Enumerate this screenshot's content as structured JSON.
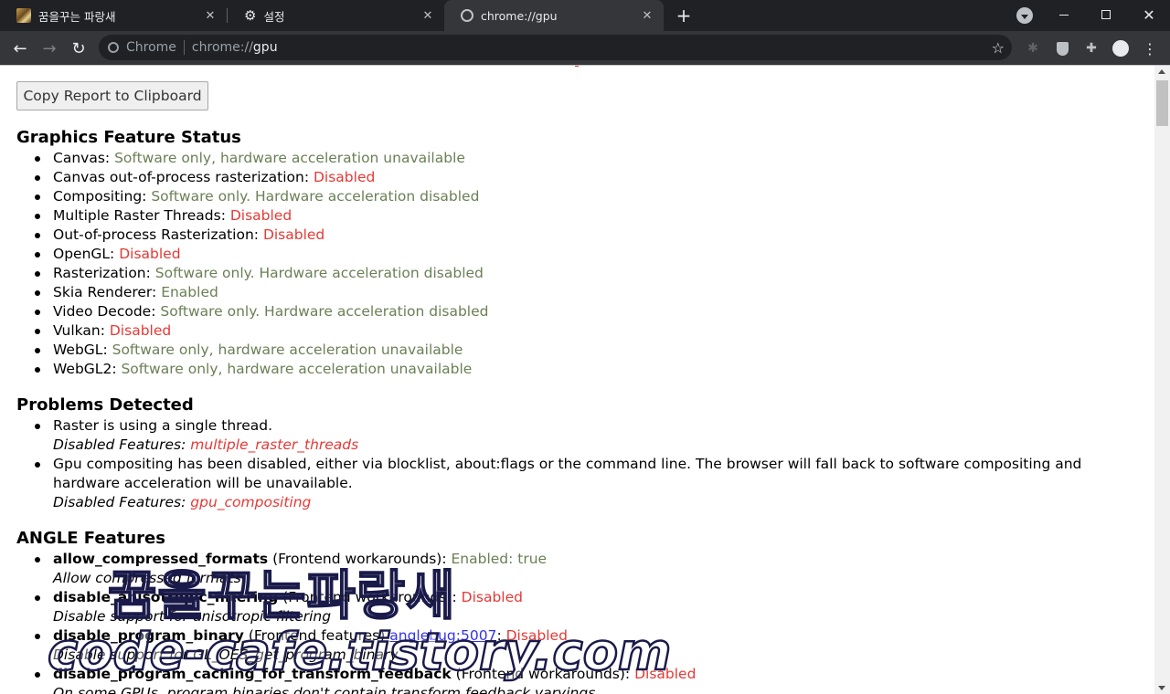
{
  "tabs": [
    {
      "title": "꿈을꾸는 파랑새",
      "favicon": "blog-avatar-icon"
    },
    {
      "title": "설정",
      "favicon": "settings-gear-icon"
    },
    {
      "title": "chrome://gpu",
      "favicon": "chrome-page-icon",
      "active": true
    }
  ],
  "omnibox": {
    "chip": "Chrome",
    "url_prefix": "chrome://",
    "url_host": "gpu"
  },
  "page": {
    "copy_button": "Copy Report to Clipboard",
    "feature_status": {
      "title": "Graphics Feature Status",
      "items": [
        {
          "name": "Canvas",
          "value": "Software only, hardware acceleration unavailable",
          "status": "software"
        },
        {
          "name": "Canvas out-of-process rasterization",
          "value": "Disabled",
          "status": "disabled"
        },
        {
          "name": "Compositing",
          "value": "Software only. Hardware acceleration disabled",
          "status": "software"
        },
        {
          "name": "Multiple Raster Threads",
          "value": "Disabled",
          "status": "disabled"
        },
        {
          "name": "Out-of-process Rasterization",
          "value": "Disabled",
          "status": "disabled"
        },
        {
          "name": "OpenGL",
          "value": "Disabled",
          "status": "disabled"
        },
        {
          "name": "Rasterization",
          "value": "Software only. Hardware acceleration disabled",
          "status": "software"
        },
        {
          "name": "Skia Renderer",
          "value": "Enabled",
          "status": "enabled"
        },
        {
          "name": "Video Decode",
          "value": "Software only. Hardware acceleration disabled",
          "status": "software"
        },
        {
          "name": "Vulkan",
          "value": "Disabled",
          "status": "disabled"
        },
        {
          "name": "WebGL",
          "value": "Software only, hardware acceleration unavailable",
          "status": "software"
        },
        {
          "name": "WebGL2",
          "value": "Software only, hardware acceleration unavailable",
          "status": "software"
        }
      ]
    },
    "problems": {
      "title": "Problems Detected",
      "items": [
        {
          "text": "Raster is using a single thread.",
          "disabled_label": "Disabled Features:",
          "feature": "multiple_raster_threads"
        },
        {
          "text": "Gpu compositing has been disabled, either via blocklist, about:flags or the command line. The browser will fall back to software compositing and hardware acceleration will be unavailable.",
          "disabled_label": "Disabled Features:",
          "feature": "gpu_compositing"
        }
      ]
    },
    "angle": {
      "title": "ANGLE Features",
      "items": [
        {
          "name": "allow_compressed_formats",
          "category": "(Frontend workarounds):",
          "state": "Enabled:",
          "state_value": "true",
          "description": "Allow compressed formats"
        },
        {
          "name": "disable_anisotropic_filtering",
          "category": "(Frontend workarounds):",
          "state": "Disabled",
          "description": "Disable support for anisotropic filtering"
        },
        {
          "name": "disable_program_binary",
          "category": "(Frontend features)",
          "link": "anglebug:5007",
          "state": "Disabled",
          "description": "Disable support for GL_OES_get_program_binary"
        },
        {
          "name": "disable_program_caching_for_transform_feedback",
          "category": "(Frontend workarounds):",
          "state": "Disabled",
          "description": "On some GPUs, program binaries don't contain transform feedback varyings"
        }
      ]
    }
  },
  "watermark": {
    "korean": "꿈을꾸는파랑새",
    "site": "code-cafe.tistory.com"
  },
  "colors": {
    "tabstrip": "#202124",
    "toolbar": "#35363a",
    "disabled": "#e53935",
    "software": "#6b7f55"
  }
}
